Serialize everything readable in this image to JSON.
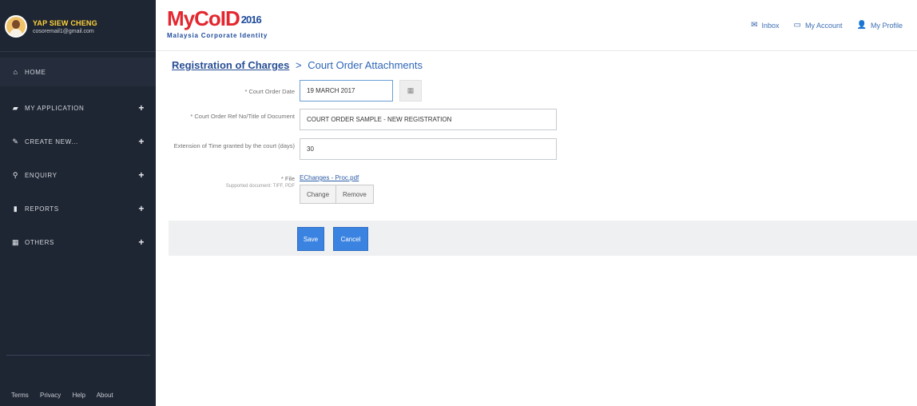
{
  "user": {
    "name": "YAP SIEW CHENG",
    "email": "cosoremail1@gmail.com"
  },
  "sidebar": {
    "items": [
      {
        "label": "HOME",
        "icon": "home-icon",
        "expandable": false
      },
      {
        "label": "MY APPLICATION",
        "icon": "briefcase-icon",
        "expandable": true
      },
      {
        "label": "CREATE NEW...",
        "icon": "edit-icon",
        "expandable": true
      },
      {
        "label": "ENQUIRY",
        "icon": "search-icon",
        "expandable": true
      },
      {
        "label": "REPORTS",
        "icon": "file-icon",
        "expandable": true
      },
      {
        "label": "OTHERS",
        "icon": "grid-icon",
        "expandable": true
      }
    ],
    "footer": [
      "Terms",
      "Privacy",
      "Help",
      "About"
    ]
  },
  "header": {
    "logo_text": "MyCoID",
    "logo_year": "2016",
    "logo_subtitle": "Malaysia Corporate Identity",
    "links": [
      {
        "label": "Inbox",
        "icon": "envelope-icon"
      },
      {
        "label": "My Account",
        "icon": "card-icon"
      },
      {
        "label": "My Profile",
        "icon": "user-icon"
      }
    ]
  },
  "breadcrumb": {
    "parent": "Registration of Charges",
    "separator": ">",
    "current": "Court Order Attachments"
  },
  "form": {
    "court_order_date": {
      "label": "* Court Order Date",
      "value": "19 MARCH 2017"
    },
    "ref_no": {
      "label": "* Court Order Ref No/Title of Document",
      "value": "COURT ORDER SAMPLE - NEW REGISTRATION"
    },
    "extension": {
      "label": "Extension of Time granted by the court (days)",
      "value": "30"
    },
    "file": {
      "label": "* File",
      "hint": "Supported document: TIFF, PDF",
      "filename": "EChanges - Proc.pdf",
      "change_label": "Change",
      "remove_label": "Remove"
    }
  },
  "actions": {
    "save_label": "Save",
    "cancel_label": "Cancel"
  },
  "colors": {
    "sidebar_bg": "#1f2633",
    "accent_blue": "#3b83e0",
    "user_name": "#ffd23a",
    "logo_red": "#e3272f",
    "logo_blue": "#1e4a9b"
  }
}
